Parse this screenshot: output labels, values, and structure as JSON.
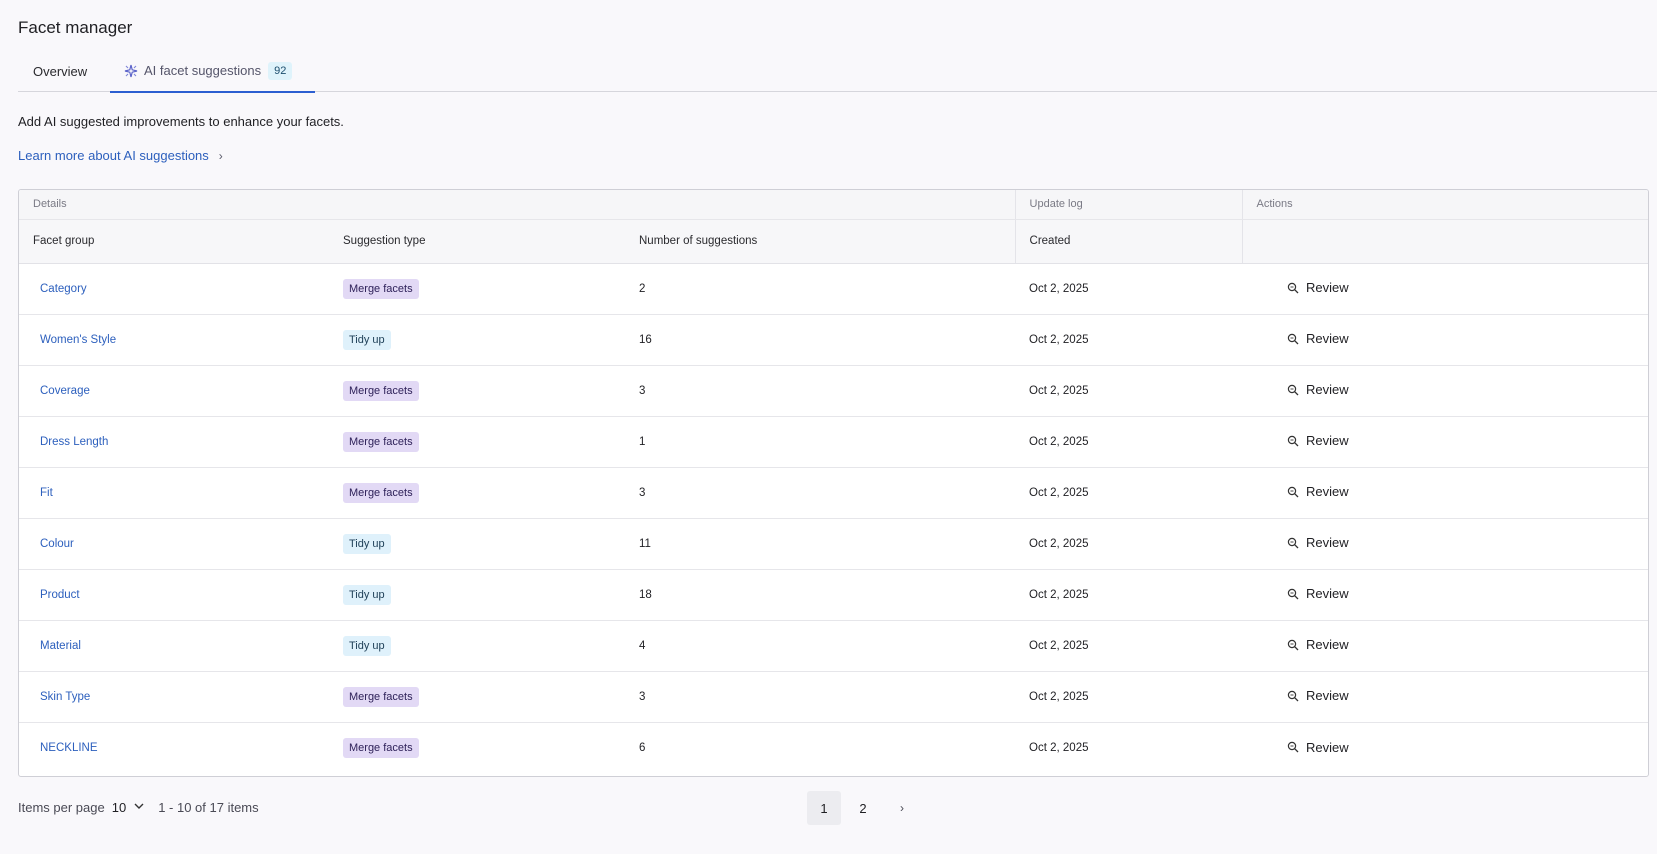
{
  "page": {
    "title": "Facet manager"
  },
  "tabs": [
    {
      "label": "Overview"
    },
    {
      "label": "AI facet suggestions",
      "count": "92",
      "icon": "ai-sparkle-icon"
    }
  ],
  "intro": "Add AI suggested improvements to enhance your facets.",
  "learn_more": "Learn more about AI suggestions",
  "table": {
    "groups": {
      "details": "Details",
      "update_log": "Update log",
      "actions": "Actions"
    },
    "columns": {
      "facet_group": "Facet group",
      "suggestion_type": "Suggestion type",
      "number": "Number of suggestions",
      "created": "Created"
    },
    "rows": [
      {
        "facet_group": "Category",
        "type": "Merge facets",
        "type_kind": "merge",
        "number": "2",
        "created": "Oct 2, 2025",
        "action": "Review"
      },
      {
        "facet_group": "Women's Style",
        "type": "Tidy up",
        "type_kind": "tidy",
        "number": "16",
        "created": "Oct 2, 2025",
        "action": "Review"
      },
      {
        "facet_group": "Coverage",
        "type": "Merge facets",
        "type_kind": "merge",
        "number": "3",
        "created": "Oct 2, 2025",
        "action": "Review"
      },
      {
        "facet_group": "Dress Length",
        "type": "Merge facets",
        "type_kind": "merge",
        "number": "1",
        "created": "Oct 2, 2025",
        "action": "Review"
      },
      {
        "facet_group": "Fit",
        "type": "Merge facets",
        "type_kind": "merge",
        "number": "3",
        "created": "Oct 2, 2025",
        "action": "Review"
      },
      {
        "facet_group": "Colour",
        "type": "Tidy up",
        "type_kind": "tidy",
        "number": "11",
        "created": "Oct 2, 2025",
        "action": "Review"
      },
      {
        "facet_group": "Product",
        "type": "Tidy up",
        "type_kind": "tidy",
        "number": "18",
        "created": "Oct 2, 2025",
        "action": "Review"
      },
      {
        "facet_group": "Material",
        "type": "Tidy up",
        "type_kind": "tidy",
        "number": "4",
        "created": "Oct 2, 2025",
        "action": "Review"
      },
      {
        "facet_group": "Skin Type",
        "type": "Merge facets",
        "type_kind": "merge",
        "number": "3",
        "created": "Oct 2, 2025",
        "action": "Review"
      },
      {
        "facet_group": "NECKLINE",
        "type": "Merge facets",
        "type_kind": "merge",
        "number": "6",
        "created": "Oct 2, 2025",
        "action": "Review"
      }
    ]
  },
  "footer": {
    "items_per_page_label": "Items per page",
    "items_per_page_value": "10",
    "range_text": "1 - 10 of 17 items",
    "pages": [
      "1",
      "2"
    ],
    "current_page": "1"
  },
  "colors": {
    "link": "#2c5fbd",
    "tab_active": "#2c5fd1",
    "merge_badge": "#e2d9f5",
    "tidy_badge": "#dff1fb"
  }
}
